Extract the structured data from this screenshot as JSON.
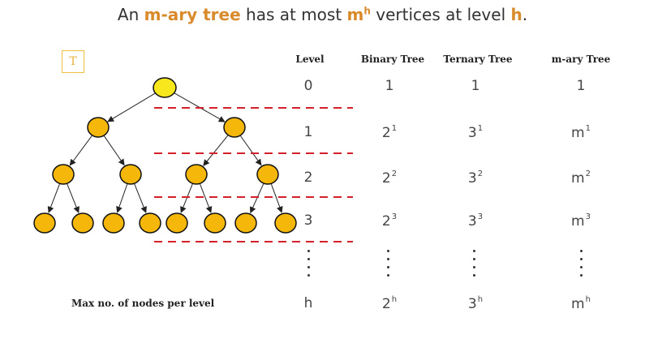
{
  "title": {
    "prefix": "An ",
    "subject": "m-ary tree",
    "middle": " has at most ",
    "base": "m",
    "exp": "h",
    "mid2": " vertices at level ",
    "level": "h",
    "suffix": "."
  },
  "tree_label": "T",
  "colors": {
    "node_fill": "#f4b70a",
    "root_fill": "#f7e81e",
    "dash": "#d4202a",
    "accent": "#d98a2b"
  },
  "table": {
    "headers": [
      "Level",
      "Binary Tree",
      "Ternary Tree",
      "m-ary Tree"
    ],
    "rows": [
      {
        "level": "0",
        "binary": {
          "b": "1",
          "e": ""
        },
        "ternary": {
          "b": "1",
          "e": ""
        },
        "mary": {
          "b": "1",
          "e": ""
        }
      },
      {
        "level": "1",
        "binary": {
          "b": "2",
          "e": "1"
        },
        "ternary": {
          "b": "3",
          "e": "1"
        },
        "mary": {
          "b": "m",
          "e": "1"
        }
      },
      {
        "level": "2",
        "binary": {
          "b": "2",
          "e": "2"
        },
        "ternary": {
          "b": "3",
          "e": "2"
        },
        "mary": {
          "b": "m",
          "e": "2"
        }
      },
      {
        "level": "3",
        "binary": {
          "b": "2",
          "e": "3"
        },
        "ternary": {
          "b": "3",
          "e": "3"
        },
        "mary": {
          "b": "m",
          "e": "3"
        }
      },
      {
        "level": "h",
        "binary": {
          "b": "2",
          "e": "h"
        },
        "ternary": {
          "b": "3",
          "e": "h"
        },
        "mary": {
          "b": "m",
          "e": "h"
        }
      }
    ],
    "footer": "Max no. of nodes per level"
  }
}
